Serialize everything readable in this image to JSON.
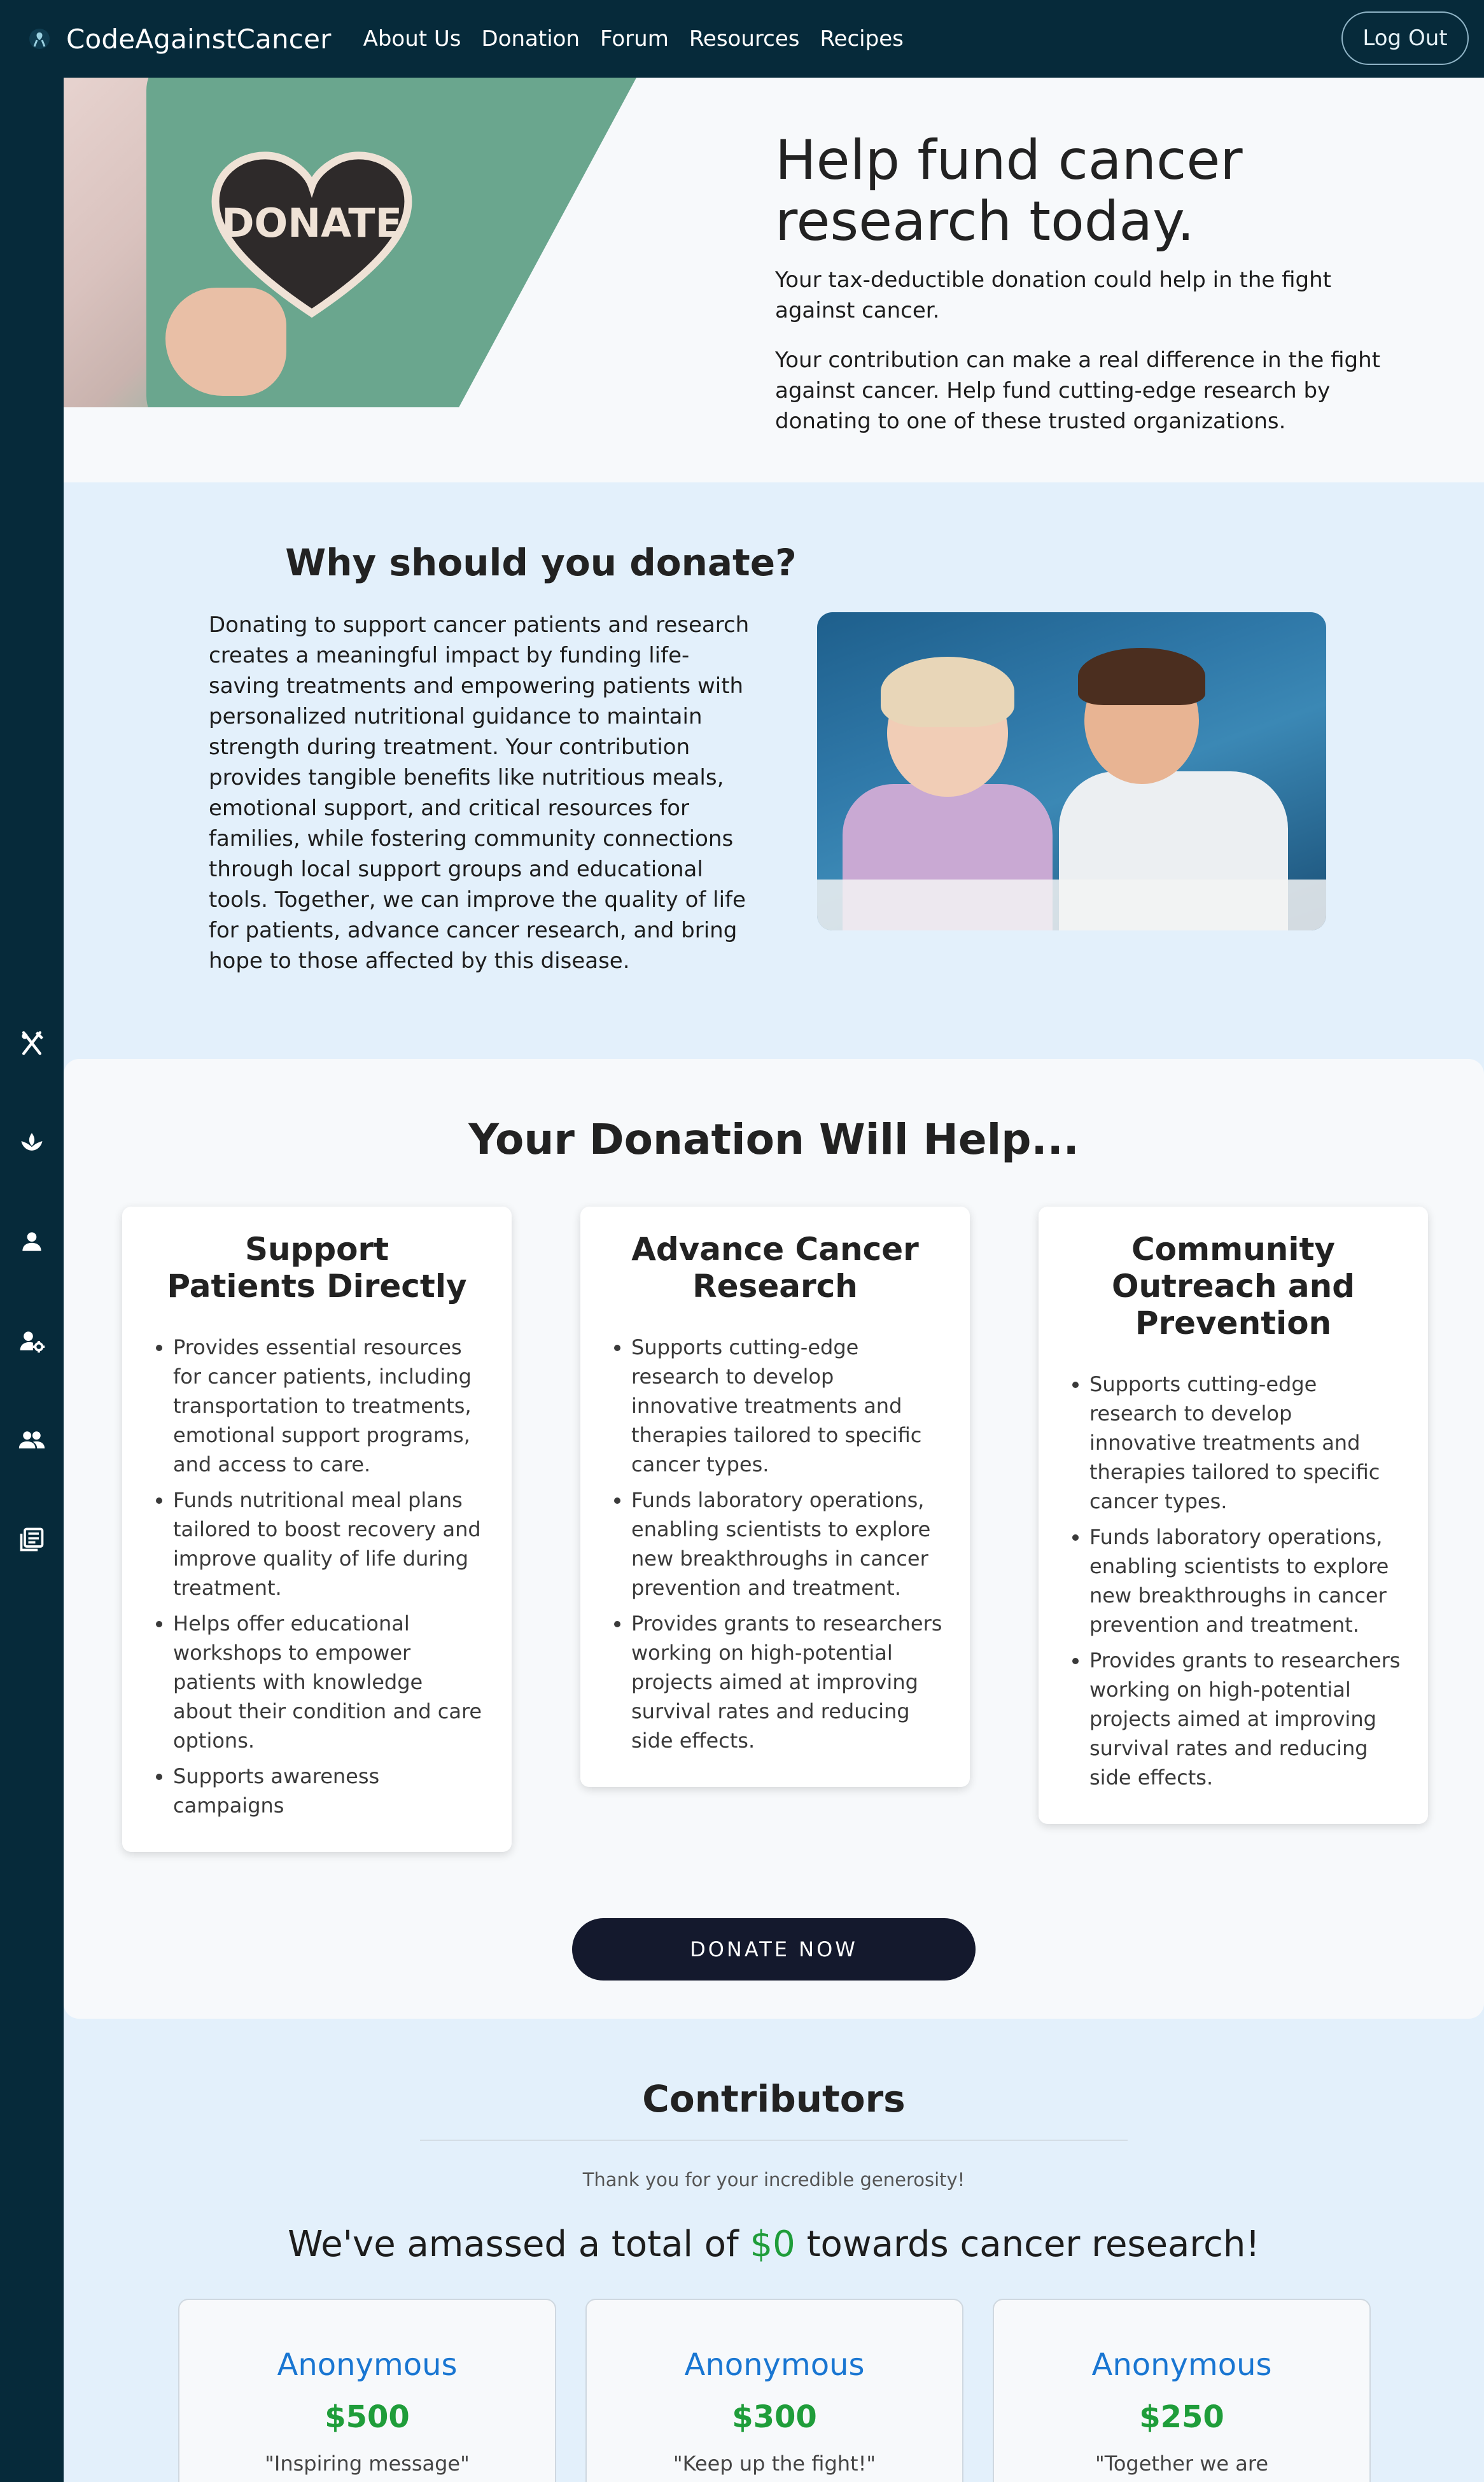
{
  "navbar": {
    "brand": "CodeAgainstCancer",
    "links": [
      "About Us",
      "Donation",
      "Forum",
      "Resources",
      "Recipes"
    ],
    "logout_label": "Log Out"
  },
  "sidebar": {
    "icons": [
      "utensils-icon",
      "lotus-icon",
      "person-icon",
      "person-settings-icon",
      "people-icon",
      "newspaper-icon"
    ]
  },
  "hero": {
    "image_text": "DONATE",
    "title": "Help fund cancer research today.",
    "paragraph1": "Your tax-deductible donation could help in the fight against cancer.",
    "paragraph2": "Your contribution can make a real difference in the fight against cancer. Help fund cutting-edge research by donating to one of these trusted organizations."
  },
  "why": {
    "title": "Why should you donate?",
    "text": "Donating to support cancer patients and research creates a meaningful impact by funding life-saving treatments and empowering patients with personalized nutritional guidance to maintain strength during treatment. Your contribution provides tangible benefits like nutritious meals, emotional support, and critical resources for families, while fostering community connections through local support groups and educational tools. Together, we can improve the quality of life for patients, advance cancer research, and bring hope to those affected by this disease."
  },
  "help": {
    "title": "Your Donation Will Help...",
    "cards": [
      {
        "title": "Support Patients Directly",
        "items": [
          "Provides essential resources for cancer patients, including transportation to treatments, emotional support programs, and access to care.",
          "Funds nutritional meal plans tailored to boost recovery and improve quality of life during treatment.",
          "Helps offer educational workshops to empower patients with knowledge about their condition and care options.",
          "Supports awareness campaigns"
        ]
      },
      {
        "title": "Advance Cancer Research",
        "items": [
          "Supports cutting-edge research to develop innovative treatments and therapies tailored to specific cancer types.",
          "Funds laboratory operations, enabling scientists to explore new breakthroughs in cancer prevention and treatment.",
          "Provides grants to researchers working on high-potential projects aimed at improving survival rates and reducing side effects."
        ]
      },
      {
        "title": "Community Outreach and Prevention",
        "items": [
          "Supports cutting-edge research to develop innovative treatments and therapies tailored to specific cancer types.",
          "Funds laboratory operations, enabling scientists to explore new breakthroughs in cancer prevention and treatment.",
          "Provides grants to researchers working on high-potential projects aimed at improving survival rates and reducing side effects."
        ]
      }
    ],
    "donate_label": "DONATE NOW"
  },
  "contributors": {
    "title": "Contributors",
    "thanks": "Thank you for your incredible generosity!",
    "total_prefix": "We've amassed a total of ",
    "total_amount": "$0",
    "total_suffix": " towards cancer research!",
    "list": [
      {
        "name": "Anonymous",
        "amount": "$500",
        "message": "\"Inspiring message\""
      },
      {
        "name": "Anonymous",
        "amount": "$300",
        "message": "\"Keep up the fight!\""
      },
      {
        "name": "Anonymous",
        "amount": "$250",
        "message": "\"Together we are"
      }
    ]
  },
  "colors": {
    "navbar": "#062a3a",
    "page_bg": "#e3f0fb",
    "accent_green": "#1f9d3a",
    "accent_blue": "#1976d2",
    "button_dark": "#14192d"
  }
}
